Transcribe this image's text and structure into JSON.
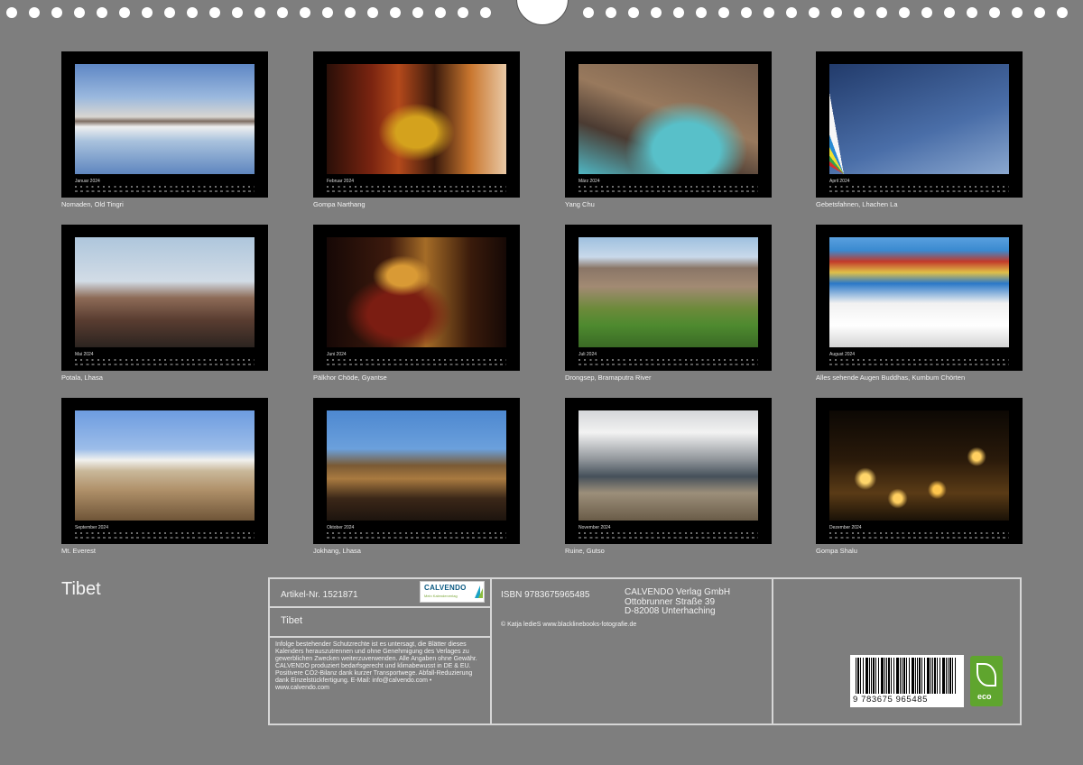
{
  "calendar": {
    "title": "Tibet",
    "months": [
      {
        "label": "Januar 2024",
        "caption": "Nomaden, Old Tingri"
      },
      {
        "label": "Februar 2024",
        "caption": "Gompa Narthang"
      },
      {
        "label": "März 2024",
        "caption": "Yang Chu"
      },
      {
        "label": "April 2024",
        "caption": "Gebetsfahnen, Lhachen La"
      },
      {
        "label": "Mai 2024",
        "caption": "Potala, Lhasa"
      },
      {
        "label": "Juni 2024",
        "caption": "Pälkhor Chöde, Gyantse"
      },
      {
        "label": "Juli 2024",
        "caption": "Drongsep, Bramaputra River"
      },
      {
        "label": "August 2024",
        "caption": "Alles sehende Augen Buddhas, Kumbum Chörten"
      },
      {
        "label": "September 2024",
        "caption": "Mt. Everest"
      },
      {
        "label": "Oktober 2024",
        "caption": "Jokhang, Lhasa"
      },
      {
        "label": "November 2024",
        "caption": "Ruine, Gutso"
      },
      {
        "label": "Dezember 2024",
        "caption": "Gompa Shalu"
      }
    ]
  },
  "info": {
    "article": "Artikel-Nr. 1521871",
    "logo_brand": "CALVENDO",
    "logo_sub": "Mein Kalenderverlag",
    "product_title": "Tibet",
    "legal": "Infolge bestehender Schutzrechte ist es untersagt, die Blätter dieses Kalenders herauszutrennen und ohne Genehmigung des Verlages zu gewerblichen Zwecken weiterzuverwenden. Alle Angaben ohne Gewähr. CALVENDO produziert bedarfsgerecht und klimabewusst in DE & EU. Positivere CO2-Bilanz dank kurzer Transportwege. Abfall-Reduzierung dank Einzelstückfertigung. E-Mail: info@calvendo.com • www.calvendo.com",
    "isbn": "ISBN 9783675965485",
    "publisher": "CALVENDO Verlag GmbH",
    "street": "Ottobrunner Straße 39",
    "city": "D-82008 Unterhaching",
    "copyright": "© Katja ledieS www.blacklinebooks-fotografie.de",
    "barcode_digits": "9 783675 965485",
    "eco_label": "eco"
  }
}
